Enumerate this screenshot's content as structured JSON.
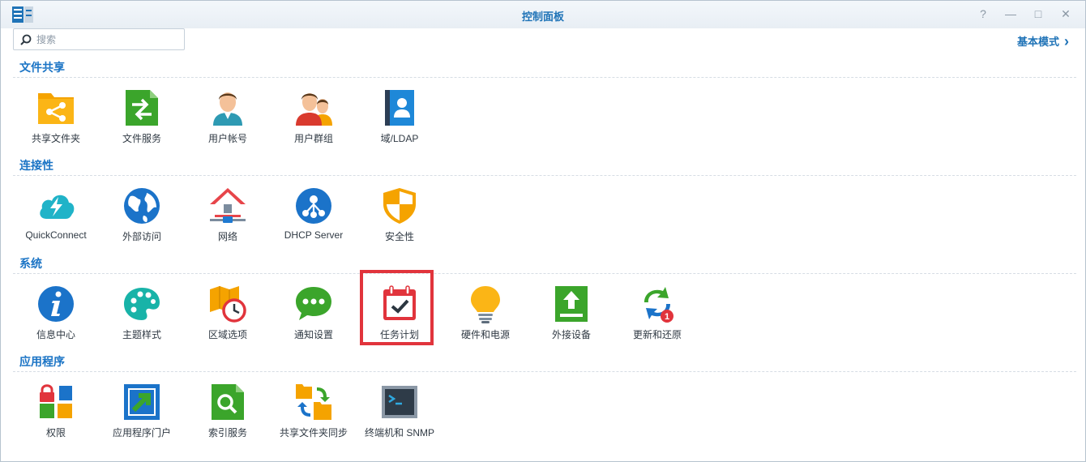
{
  "window": {
    "title": "控制面板",
    "controls": {
      "help": "?",
      "minimize": "—",
      "maximize": "□",
      "close": "✕"
    }
  },
  "search": {
    "placeholder": "搜索",
    "value": ""
  },
  "mode_link": {
    "label": "基本模式",
    "chevron": "›"
  },
  "sections": [
    {
      "title": "文件共享",
      "items": [
        {
          "label": "共享文件夹",
          "icon": "shared-folder-icon"
        },
        {
          "label": "文件服务",
          "icon": "file-services-icon"
        },
        {
          "label": "用户帐号",
          "icon": "user-icon"
        },
        {
          "label": "用户群组",
          "icon": "group-icon"
        },
        {
          "label": "域/LDAP",
          "icon": "domain-ldap-icon"
        }
      ]
    },
    {
      "title": "连接性",
      "items": [
        {
          "label": "QuickConnect",
          "icon": "quickconnect-icon"
        },
        {
          "label": "外部访问",
          "icon": "external-access-icon"
        },
        {
          "label": "网络",
          "icon": "network-icon"
        },
        {
          "label": "DHCP Server",
          "icon": "dhcp-server-icon"
        },
        {
          "label": "安全性",
          "icon": "security-shield-icon"
        }
      ]
    },
    {
      "title": "系统",
      "items": [
        {
          "label": "信息中心",
          "icon": "info-center-icon"
        },
        {
          "label": "主题样式",
          "icon": "theme-palette-icon"
        },
        {
          "label": "区域选项",
          "icon": "regional-options-icon"
        },
        {
          "label": "通知设置",
          "icon": "notification-icon"
        },
        {
          "label": "任务计划",
          "icon": "task-scheduler-icon"
        },
        {
          "label": "硬件和电源",
          "icon": "hardware-power-icon"
        },
        {
          "label": "外接设备",
          "icon": "external-devices-icon"
        },
        {
          "label": "更新和还原",
          "icon": "update-restore-icon",
          "badge": "1"
        }
      ]
    },
    {
      "title": "应用程序",
      "items": [
        {
          "label": "权限",
          "icon": "privileges-icon"
        },
        {
          "label": "应用程序门户",
          "icon": "application-portal-icon"
        },
        {
          "label": "索引服务",
          "icon": "indexing-service-icon"
        },
        {
          "label": "共享文件夹同步",
          "icon": "shared-folder-sync-icon"
        },
        {
          "label": "终端机和 SNMP",
          "icon": "terminal-snmp-icon"
        }
      ]
    }
  ],
  "highlighted_item": "任务计划",
  "colors": {
    "accent": "#1b74c5",
    "highlight": "#e1343c"
  }
}
